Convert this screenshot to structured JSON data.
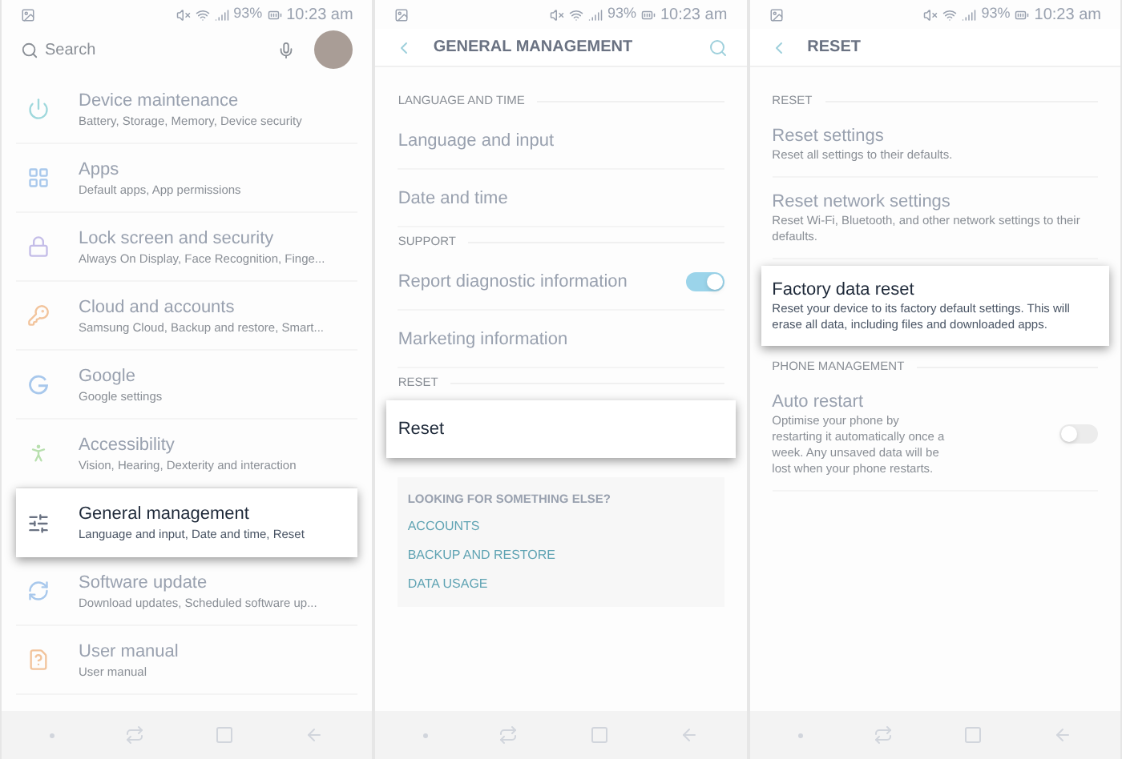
{
  "screens": [
    {
      "kind": "home",
      "status": {
        "battery": "93%",
        "time": "10:23 am"
      },
      "search": {
        "placeholder": "Search"
      },
      "items": [
        {
          "title": "Device maintenance",
          "subtitle": "Battery, Storage, Memory, Device security",
          "highlighted": false
        },
        {
          "title": "Apps",
          "subtitle": "Default apps, App permissions",
          "highlighted": false
        },
        {
          "title": "Lock screen and security",
          "subtitle": "Always On Display, Face Recognition, Finge...",
          "highlighted": false
        },
        {
          "title": "Cloud and accounts",
          "subtitle": "Samsung Cloud, Backup and restore, Smart...",
          "highlighted": false
        },
        {
          "title": "Google",
          "subtitle": "Google settings",
          "highlighted": false
        },
        {
          "title": "Accessibility",
          "subtitle": "Vision, Hearing, Dexterity and interaction",
          "highlighted": false
        },
        {
          "title": "General management",
          "subtitle": "Language and input, Date and time, Reset",
          "highlighted": true
        },
        {
          "title": "Software update",
          "subtitle": "Download updates, Scheduled software up...",
          "highlighted": false
        },
        {
          "title": "User manual",
          "subtitle": "User manual",
          "highlighted": false
        }
      ]
    },
    {
      "kind": "list",
      "status": {
        "battery": "93%",
        "time": "10:23 am"
      },
      "header": {
        "title": "GENERAL MANAGEMENT",
        "search": true
      },
      "sections": [
        {
          "heading": "LANGUAGE AND TIME",
          "rows": [
            {
              "kind": "plain",
              "title": "Language and input",
              "highlighted": false
            },
            {
              "kind": "plain",
              "title": "Date and time",
              "highlighted": false
            }
          ]
        },
        {
          "heading": "SUPPORT",
          "rows": [
            {
              "kind": "toggle",
              "title": "Report diagnostic information",
              "on": true,
              "highlighted": false
            },
            {
              "kind": "plain",
              "title": "Marketing information",
              "highlighted": false
            }
          ]
        },
        {
          "heading": "RESET",
          "rows": [
            {
              "kind": "plain",
              "title": "Reset",
              "highlighted": true
            }
          ]
        }
      ],
      "suggestions": {
        "heading": "LOOKING FOR SOMETHING ELSE?",
        "links": [
          "ACCOUNTS",
          "BACKUP AND RESTORE",
          "DATA USAGE"
        ]
      }
    },
    {
      "kind": "list",
      "status": {
        "battery": "93%",
        "time": "10:23 am"
      },
      "header": {
        "title": "RESET",
        "search": false
      },
      "sections": [
        {
          "heading": "RESET",
          "rows": [
            {
              "kind": "plain",
              "title": "Reset settings",
              "subtitle": "Reset all settings to their defaults.",
              "highlighted": false
            },
            {
              "kind": "plain",
              "title": "Reset network settings",
              "subtitle": "Reset Wi-Fi, Bluetooth, and other network settings to their defaults.",
              "highlighted": false
            },
            {
              "kind": "plain",
              "title": "Factory data reset",
              "subtitle": "Reset your device to its factory default settings. This will erase all data, including files and downloaded apps.",
              "highlighted": true
            }
          ]
        },
        {
          "heading": "PHONE MANAGEMENT",
          "rows": [
            {
              "kind": "toggle",
              "title": "Auto restart",
              "subtitle": "Optimise your phone by restarting it automatically once a week. Any unsaved data will be lost when your phone restarts.",
              "on": false,
              "highlighted": false
            }
          ]
        }
      ]
    }
  ]
}
